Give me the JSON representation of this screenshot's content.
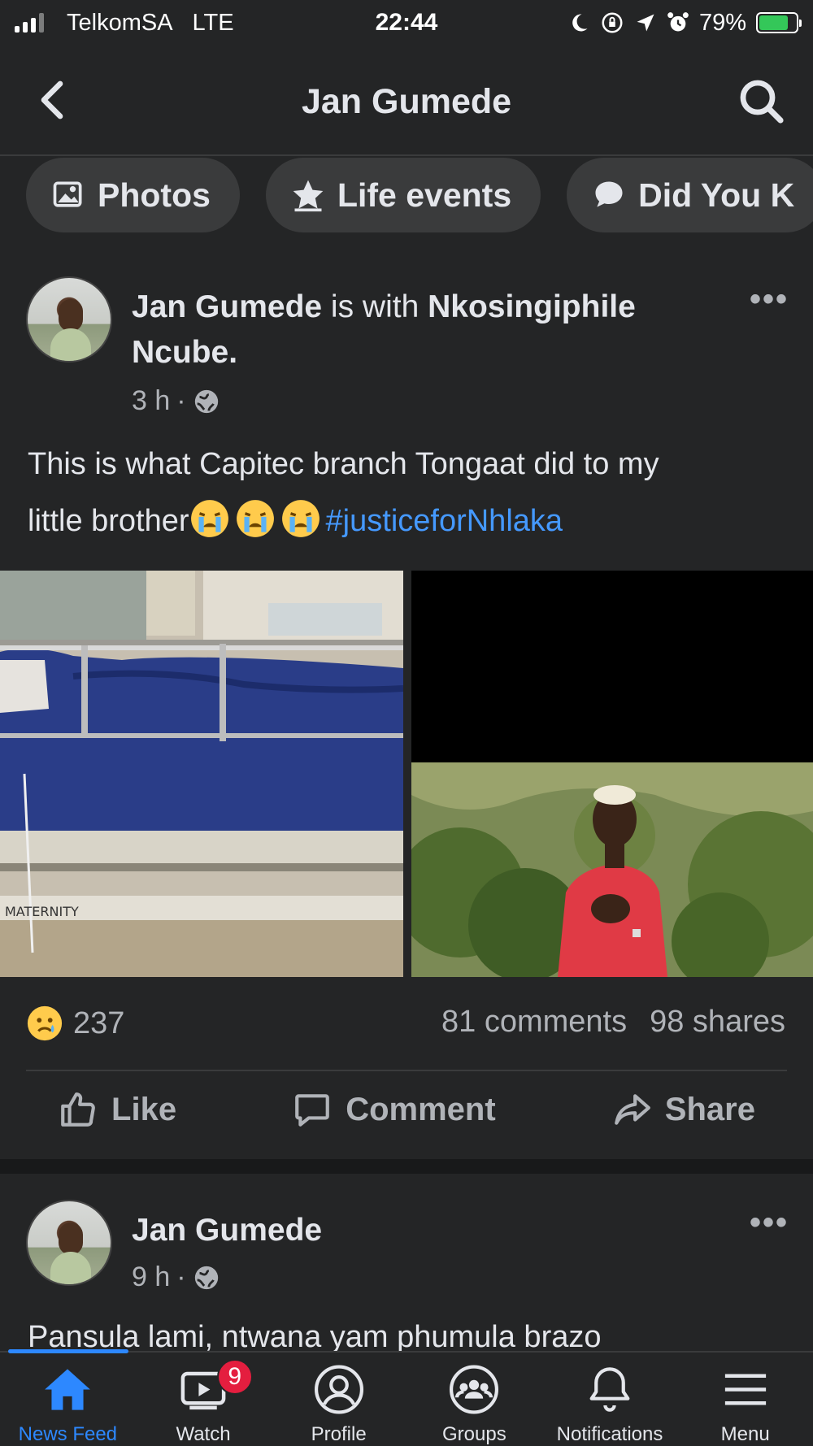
{
  "status_bar": {
    "carrier": "TelkomSA",
    "network": "LTE",
    "time": "22:44",
    "battery": "79%",
    "battery_level": 0.79
  },
  "header": {
    "title": "Jan Gumede",
    "back_icon": "chevron-left-icon",
    "search_icon": "search-icon"
  },
  "chips": [
    {
      "label": "Photos",
      "icon": "photos-icon"
    },
    {
      "label": "Life events",
      "icon": "star-icon"
    },
    {
      "label": "Did You K",
      "icon": "speech-bubble-icon"
    }
  ],
  "post1": {
    "author": "Jan Gumede",
    "with_text": " is with ",
    "tagged": "Nkosingiphile",
    "tagged_line2": "Ncube.",
    "time": "3 h",
    "dot": "·",
    "text": "This is what Capitec branch Tongaat did to my",
    "text_line2": "little brother",
    "hashtag": "#justiceforNhlaka",
    "emoji": "crying-face-icon",
    "reaction_count": "237",
    "reaction_icon": "sad-face-icon",
    "comments": "81 comments",
    "shares": "98 shares",
    "image_label": "MATERNITY",
    "actions": {
      "like": "Like",
      "comment": "Comment",
      "share": "Share"
    }
  },
  "post2": {
    "author": "Jan Gumede",
    "time": "9 h",
    "dot": "·",
    "text": "Pansula lami, ntwana yam phumula brazo"
  },
  "tabbar": [
    {
      "label": "News Feed",
      "icon": "home-icon",
      "active": true
    },
    {
      "label": "Watch",
      "icon": "video-icon",
      "badge": "9"
    },
    {
      "label": "Profile",
      "icon": "profile-icon"
    },
    {
      "label": "Groups",
      "icon": "groups-icon"
    },
    {
      "label": "Notifications",
      "icon": "bell-icon"
    },
    {
      "label": "Menu",
      "icon": "menu-icon"
    }
  ],
  "colors": {
    "background": "#242526",
    "accent": "#2d88ff",
    "hashtag": "#4599ff",
    "badge": "#e41e3f"
  }
}
